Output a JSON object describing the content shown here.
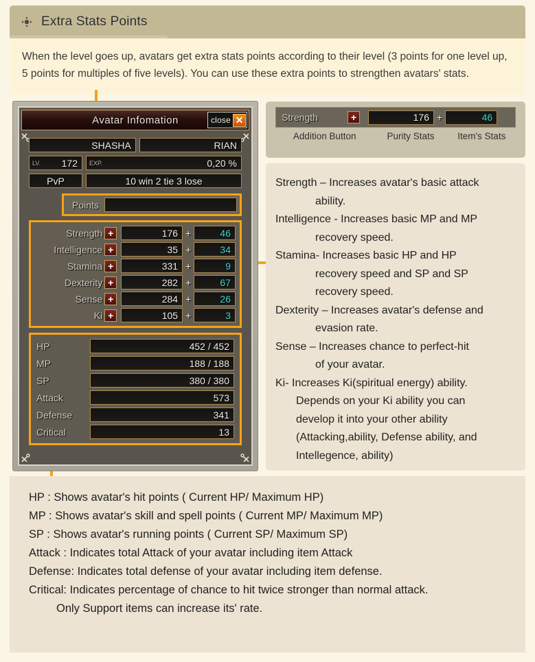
{
  "header": {
    "title": "Extra Stats Points",
    "move_icon": "move-crosshair-icon"
  },
  "intro": {
    "text": "When the level goes up, avatars get extra stats points according to their level (3 points for one level up, 5 points for multiples of five levels). You can use these extra points to strengthen avatars' stats."
  },
  "game_window": {
    "title": "Avatar Infomation",
    "close_label": "close",
    "close_icon": "close-x-icon",
    "identity": {
      "name_left": "SHASHA",
      "name_right": "RIAN"
    },
    "level": {
      "tag": "LV.",
      "value": "172"
    },
    "exp": {
      "tag": "EXP.",
      "value": "0,20 %"
    },
    "pvp": {
      "label": "PvP",
      "value": "10 win  2 tie 3 lose"
    },
    "points": {
      "label": "Points",
      "value": ""
    },
    "stats": [
      {
        "label": "Strength",
        "base": "176",
        "op": "+",
        "item": "46"
      },
      {
        "label": "Intelligence",
        "base": "35",
        "op": "+",
        "item": "34"
      },
      {
        "label": "Stamina",
        "base": "331",
        "op": "+",
        "item": "9"
      },
      {
        "label": "Dexterity",
        "base": "282",
        "op": "+",
        "item": "67"
      },
      {
        "label": "Sense",
        "base": "284",
        "op": "+",
        "item": "26"
      },
      {
        "label": "Ki",
        "base": "105",
        "op": "+",
        "item": "3"
      }
    ],
    "plus_button_glyph": "+",
    "vitals": [
      {
        "label": "HP",
        "value": "452 / 452"
      },
      {
        "label": "MP",
        "value": "188 / 188"
      },
      {
        "label": "SP",
        "value": "380 / 380"
      },
      {
        "label": "Attack",
        "value": "573"
      },
      {
        "label": "Defense",
        "value": "341"
      },
      {
        "label": "Critical",
        "value": "13"
      }
    ]
  },
  "legend": {
    "stat_label": "Strength",
    "base_value": "176",
    "op": "+",
    "item_value": "46",
    "captions": {
      "addition": "Addition Button",
      "purity": "Purity Stats",
      "item": "Item's Stats"
    }
  },
  "descriptions": {
    "lines": [
      {
        "text": "Strength – Increases avatar's basic attack",
        "indent": 0
      },
      {
        "text": "ability.",
        "indent": 1
      },
      {
        "text": "Intelligence - Increases basic MP and MP",
        "indent": 0
      },
      {
        "text": "recovery speed.",
        "indent": 1
      },
      {
        "text": "Stamina- Increases basic HP and HP",
        "indent": 0
      },
      {
        "text": "recovery speed and SP and SP",
        "indent": 1
      },
      {
        "text": "recovery speed.",
        "indent": 1
      },
      {
        "text": "Dexterity – Increases avatar's defense and",
        "indent": 0
      },
      {
        "text": "evasion rate.",
        "indent": 1
      },
      {
        "text": "Sense – Increases chance to perfect-hit",
        "indent": 0
      },
      {
        "text": "of your avatar.",
        "indent": 1
      },
      {
        "text": "Ki- Increases Ki(spiritual energy) ability.",
        "indent": 0
      },
      {
        "text": "Depends on your Ki ability you can",
        "indent": 2
      },
      {
        "text": "develop it into your other ability",
        "indent": 2
      },
      {
        "text": "(Attacking,ability, Defense ability, and",
        "indent": 2
      },
      {
        "text": "Intellegence, ability)",
        "indent": 2
      }
    ]
  },
  "bottom": {
    "lines": [
      {
        "text": "HP : Shows avatar's hit points ( Current HP/ Maximum HP)",
        "indent": 0
      },
      {
        "text": "MP : Shows avatar's skill and spell points ( Current MP/ Maximum MP)",
        "indent": 0
      },
      {
        "text": "SP : Shows avatar's running points ( Current SP/ Maximum SP)",
        "indent": 0
      },
      {
        "text": "Attack : Indicates total Attack of your avatar including item Attack",
        "indent": 0
      },
      {
        "text": "Defense: Indicates total defense of your avatar including item defense.",
        "indent": 0
      },
      {
        "text": "Critical: Indicates percentage of chance to hit twice stronger than normal attack.",
        "indent": 0
      },
      {
        "text": "Only Support items can increase its' rate.",
        "indent": 1
      }
    ]
  },
  "colors": {
    "accent_orange": "#F5A318",
    "header_bar": "#C2B894",
    "intro_bg": "#FDF3D8",
    "panel_bg": "#EDE3D2",
    "item_stat_teal": "#3DD6D0"
  }
}
